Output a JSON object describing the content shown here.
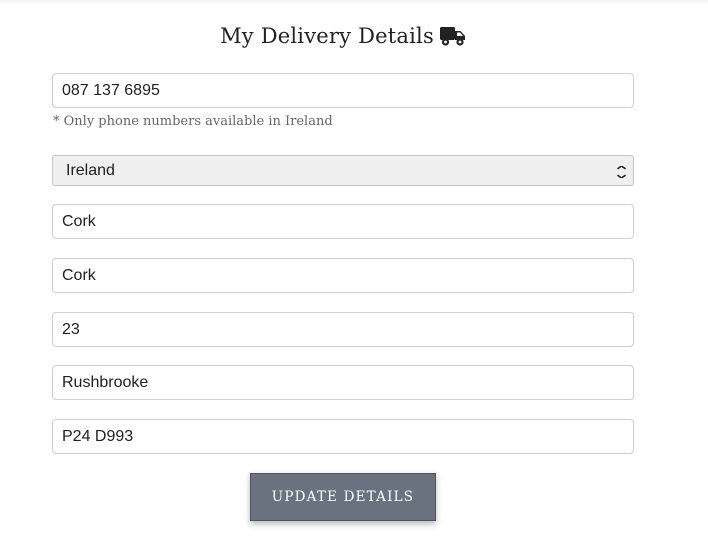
{
  "header": {
    "title": "My Delivery Details",
    "icon": "truck-icon"
  },
  "form": {
    "phone": {
      "value": "087 137 6895"
    },
    "phone_hint": "* Only phone numbers available in Ireland",
    "country": {
      "selected": "Ireland"
    },
    "city": {
      "value": "Cork"
    },
    "county": {
      "value": "Cork"
    },
    "house_number": {
      "value": "23"
    },
    "street": {
      "value": "Rushbrooke"
    },
    "postcode": {
      "value": "P24 D993"
    }
  },
  "actions": {
    "update_label": "UPDATE DETAILS"
  },
  "colors": {
    "button_bg": "#6a7280",
    "field_border": "#cfcfcf",
    "select_bg": "#efefef"
  }
}
